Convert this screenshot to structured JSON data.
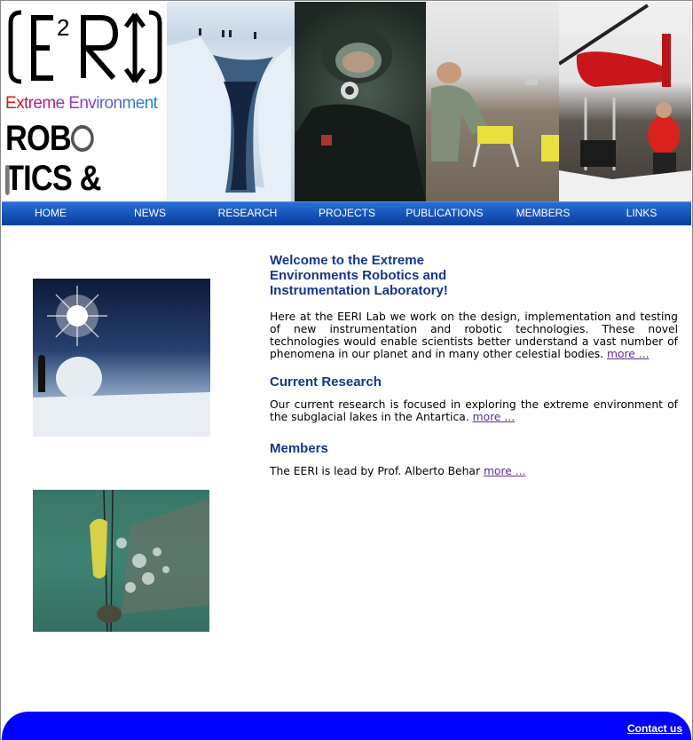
{
  "logo": {
    "mark": "E²RI",
    "tagline_line1": "Extreme Environment",
    "tagline_line2": "ROBOTICS &",
    "tagline_line3": "INSTRUMENTATION",
    "colors": {
      "rainbow_start": "#d11a1a",
      "rainbow_mid": "#8a3fd0",
      "rainbow_end": "#1f88c8"
    }
  },
  "nav": {
    "items": [
      {
        "label": "HOME"
      },
      {
        "label": "NEWS"
      },
      {
        "label": "RESEARCH"
      },
      {
        "label": "PROJECTS"
      },
      {
        "label": "PUBLICATIONS"
      },
      {
        "label": "MEMBERS"
      },
      {
        "label": "LINKS"
      }
    ]
  },
  "main": {
    "welcome_title": "Welcome to the Extreme Environments Robotics and Instrumentation Laboratory!",
    "welcome_text": "Here at the EERI Lab we work on the design, implementation and testing of new instrumentation and robotic technologies. These novel technologies would enable scientists better understand a vast number of phenomena in our planet and in many other celestial bodies.",
    "welcome_more": "more ...",
    "research_title": "Current Research",
    "research_text": "Our current research is focused in exploring the extreme environment of the subglacial lakes in the Antartica.",
    "research_more": "more ...",
    "members_title": "Members",
    "members_text": "The EERI is lead by Prof. Alberto Behar",
    "members_more": "more ..."
  },
  "footer": {
    "contact": "Contact us"
  },
  "colors": {
    "nav_blue": "#1652b8",
    "heading_blue": "#14378a",
    "footer_blue": "#0000ff",
    "link_visited": "#5b2d8c"
  }
}
